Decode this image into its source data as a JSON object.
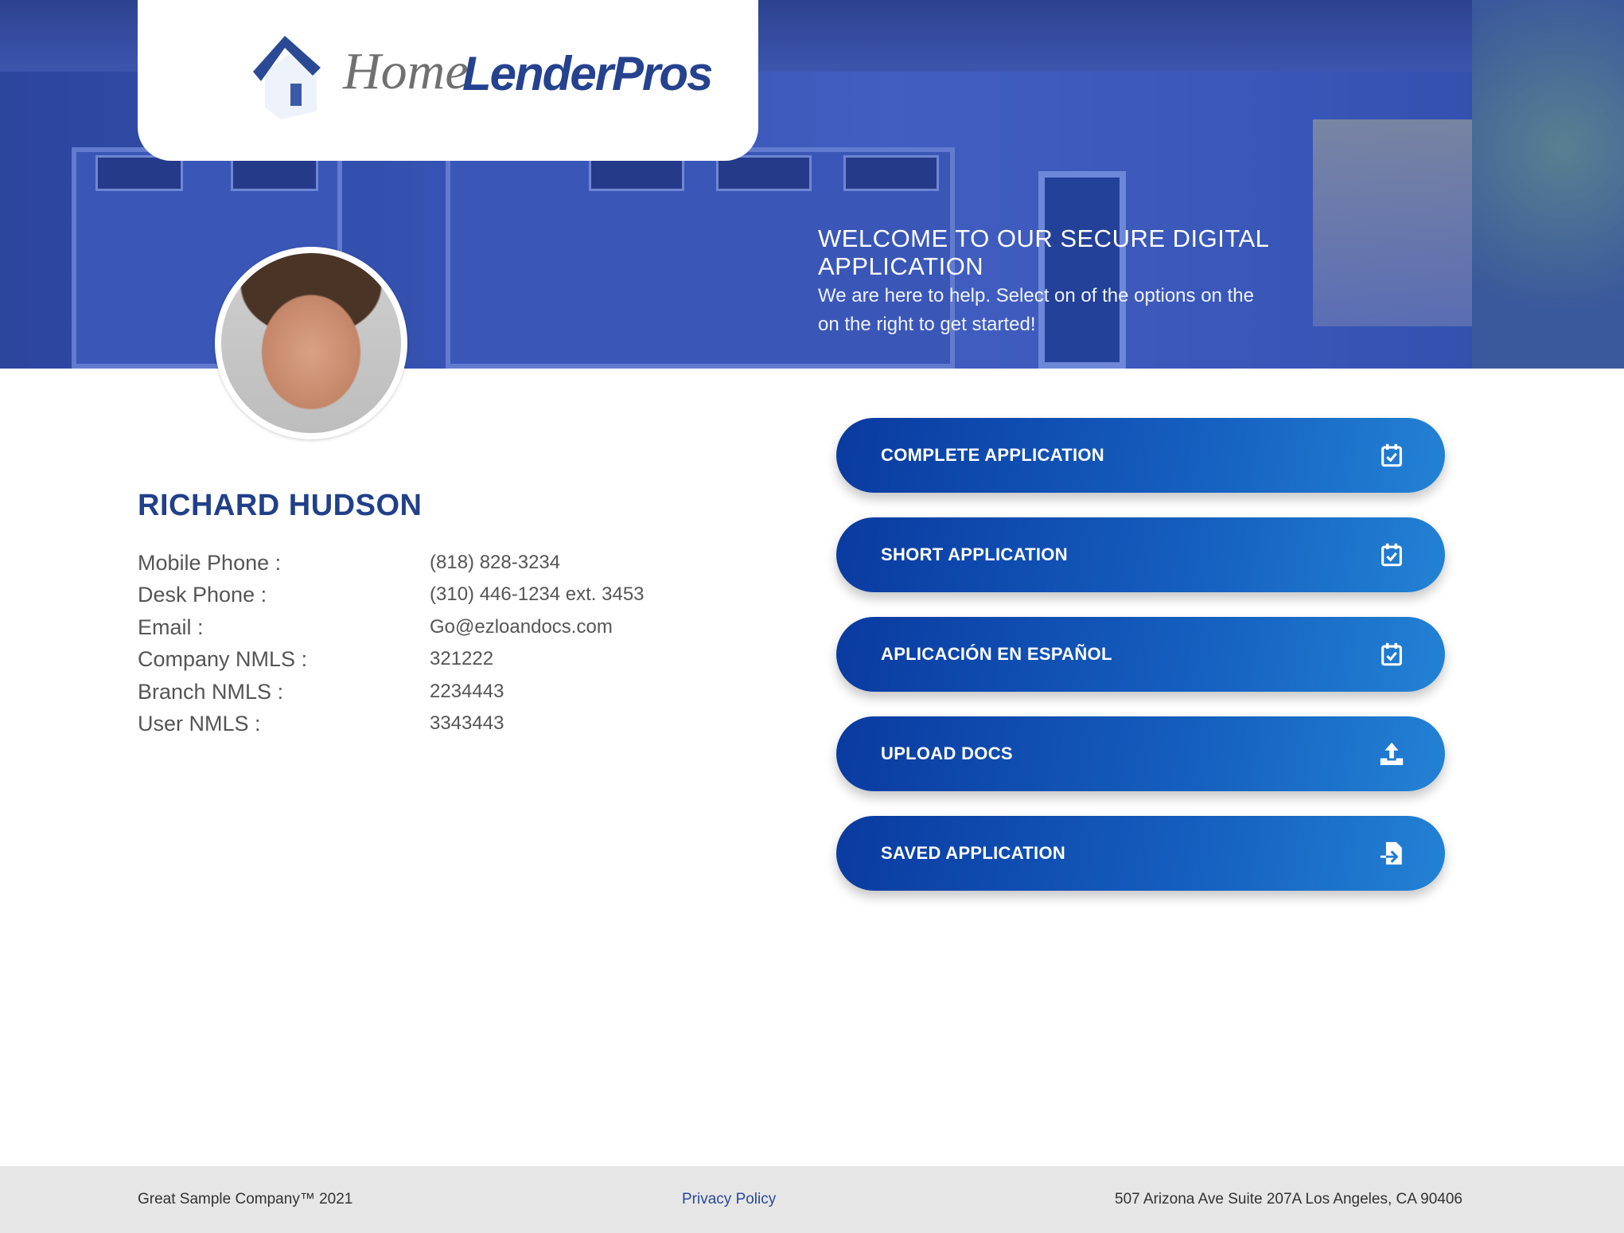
{
  "brand": {
    "logo_text_1": "Home",
    "logo_text_2": "LenderPros"
  },
  "hero": {
    "title": "WELCOME TO OUR SECURE DIGITAL APPLICATION",
    "subtitle": "We are here to help. Select on of the options on the on the right to get started!"
  },
  "officer": {
    "name": "RICHARD HUDSON",
    "fields": [
      {
        "label": "Mobile Phone :",
        "value": "(818) 828-3234"
      },
      {
        "label": "Desk Phone :",
        "value": "(310) 446-1234 ext. 3453"
      },
      {
        "label": "Email :",
        "value": "Go@ezloandocs.com"
      },
      {
        "label": "Company NMLS :",
        "value": "321222"
      },
      {
        "label": "Branch NMLS :",
        "value": "2234443"
      },
      {
        "label": "User NMLS :",
        "value": "3343443"
      }
    ]
  },
  "actions": [
    {
      "label": "COMPLETE APPLICATION",
      "icon": "calendar-check-icon"
    },
    {
      "label": "SHORT APPLICATION",
      "icon": "calendar-check-icon"
    },
    {
      "label": "APLICACIÓN EN ESPAÑOL",
      "icon": "calendar-check-icon"
    },
    {
      "label": "UPLOAD DOCS",
      "icon": "upload-icon"
    },
    {
      "label": "SAVED APPLICATION",
      "icon": "file-import-icon"
    }
  ],
  "footer": {
    "copyright": "Great Sample Company™ 2021",
    "privacy": "Privacy Policy",
    "address": "507 Arizona Ave Suite 207A Los Angeles, CA 90406"
  },
  "colors": {
    "primary": "#21408a",
    "button_start": "#0a3aa0",
    "button_end": "#2382d4",
    "footer_bg": "#e6e6e6"
  }
}
